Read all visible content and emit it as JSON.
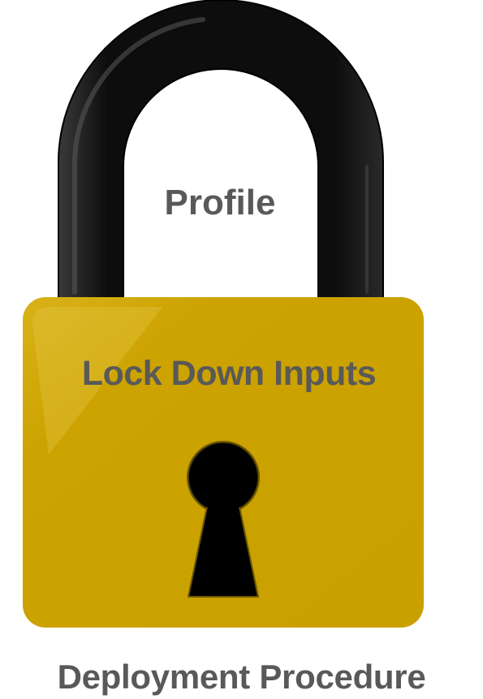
{
  "diagram": {
    "shackle_label": "Profile",
    "body_label": "Lock Down Inputs",
    "caption": "Deployment Procedure"
  },
  "colors": {
    "shackle": "#111111",
    "lock_body": "#cca300",
    "keyhole": "#000000",
    "label_text": "#595959"
  },
  "icons": {
    "main": "padlock-icon",
    "keyhole": "keyhole-icon"
  }
}
